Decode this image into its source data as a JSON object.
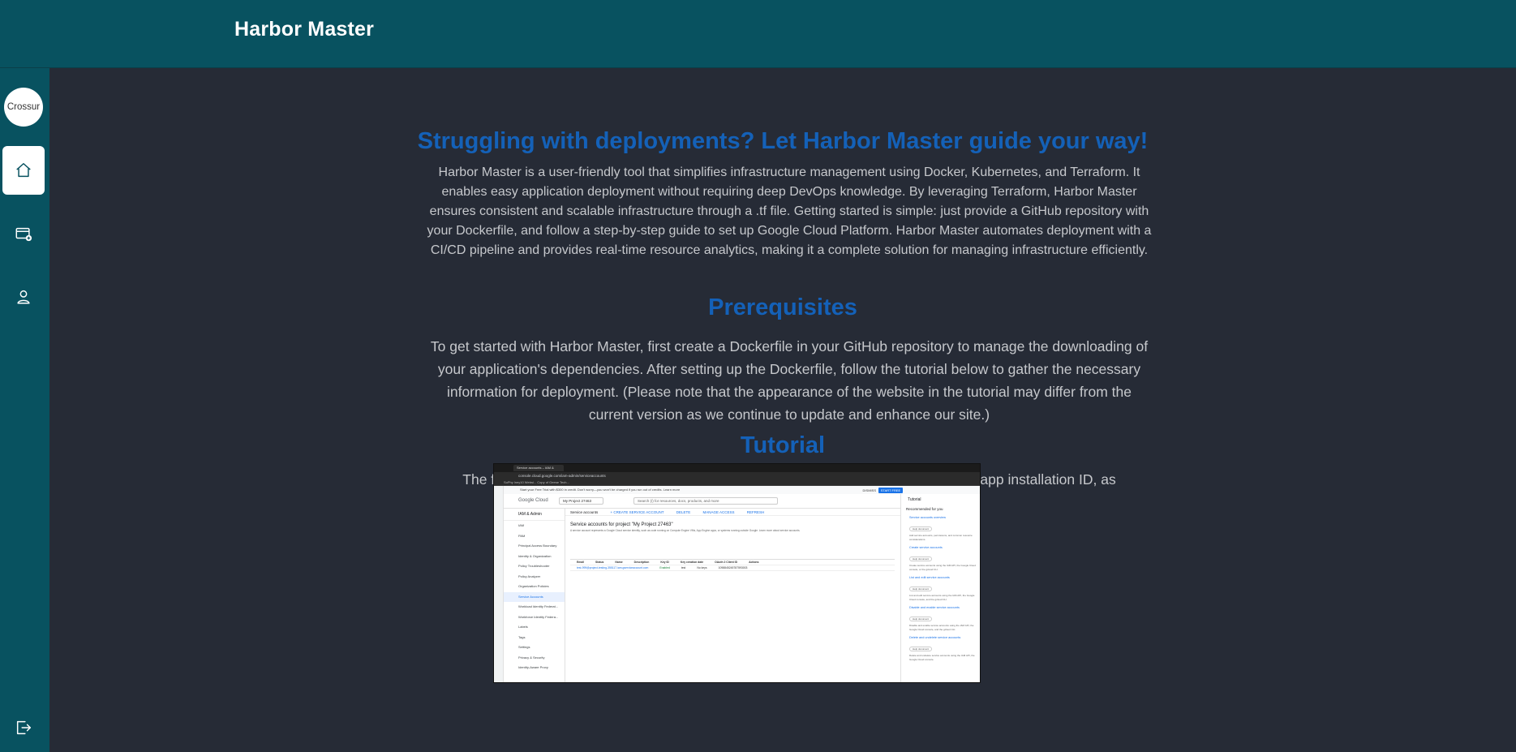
{
  "app": {
    "title": "Harbor Master"
  },
  "sidebar": {
    "avatar_text": "Crossur",
    "items": [
      {
        "name": "home-icon"
      },
      {
        "name": "new-deployment-icon"
      },
      {
        "name": "user-icon"
      },
      {
        "name": "logout-icon"
      }
    ]
  },
  "intro": {
    "heading": "Struggling with deployments? Let Harbor Master guide your way!",
    "body": "Harbor Master is a user-friendly tool that simplifies infrastructure management using Docker, Kubernetes, and Terraform. It enables easy application deployment without requiring deep DevOps knowledge. By leveraging Terraform, Harbor Master ensures consistent and scalable infrastructure through a .tf file. Getting started is simple: just provide a GitHub repository with your Dockerfile, and follow a step-by-step guide to set up Google Cloud Platform. Harbor Master automates deployment with a CI/CD pipeline and provides real-time resource analytics, making it a complete solution for managing infrastructure efficiently."
  },
  "prerequisites": {
    "heading": "Prerequisites",
    "body": "To get started with Harbor Master, first create a Dockerfile in your GitHub repository to manage the downloading of your application's dependencies. After setting up the Dockerfile, follow the tutorial below to gather the necessary information for deployment. (Please note that the appearance of the website in the tutorial may differ from the current version as we continue to update and enhance our site.)"
  },
  "tutorial": {
    "heading": "Tutorial",
    "body": "The first step is to add Google Cloud Build with your GitHub account and save the app installation ID, as demonstrated below.",
    "screenshot": {
      "tab_title": "Service accounts – IAM &",
      "url": "console.cloud.google.com/iam-admin/serviceaccounts",
      "bookmarks": "SoPhy lney10 Websi...   Copy of Geese Tech...",
      "banner": "Start your Free Trial with $300 in credit. Don't worry—you won't be charged if you run out of credits. Learn more",
      "dismiss": "DISMISS",
      "start_free": "START FREE",
      "brand": "Google Cloud",
      "project": "My Project 27463",
      "search_placeholder": "Search (/) for resources, docs, products, and more",
      "nav_title": "IAM & Admin",
      "nav_items": [
        "IAM",
        "PAM",
        "Principal Access Boundary",
        "Identity & Organization",
        "Policy Troubleshooter",
        "Policy Analyzer",
        "Organization Policies",
        "Service Accounts",
        "Workload Identity Federat...",
        "Workforce Identity Federa...",
        "Labels",
        "Tags",
        "Settings",
        "Privacy & Security",
        "Identity-Aware Proxy"
      ],
      "toolbar_title": "Service accounts",
      "toolbar_actions": [
        "+ CREATE SERVICE ACCOUNT",
        "DELETE",
        "MANAGE ACCESS",
        "REFRESH"
      ],
      "main_heading": "Service accounts for project \"My Project 27463\"",
      "fine_print": "A service account represents a Google Cloud service identity, such as code running on Compute Engine VMs, App Engine apps, or systems running outside Google. Learn more about service accounts.",
      "table_header": [
        "Email",
        "Status",
        "Name",
        "Description",
        "Key ID",
        "Key creation date",
        "OAuth 2 Client ID",
        "Actions"
      ],
      "table_row": [
        "test-999@project-testing-355117.iam.gserviceaccount.com",
        "Enabled",
        "test",
        "",
        "No keys",
        "",
        "1098845245787593003",
        ""
      ],
      "panel_title": "Tutorial",
      "panel_sub": "Recommended for you",
      "panel_items": [
        {
          "title": "Service accounts overview",
          "tag": "Help document",
          "desc": "Add service accounts, permissions, and common resource considerations."
        },
        {
          "title": "Create service accounts",
          "tag": "Help document",
          "desc": "Create service accounts using the IAM API, the Google Cloud console, or the gcloud CLI."
        },
        {
          "title": "List and edit service accounts",
          "tag": "Help document",
          "desc": "List and edit service accounts using the IAM API, the Google Cloud console, and the gcloud CLI."
        },
        {
          "title": "Disable and enable service accounts",
          "tag": "Help document",
          "desc": "Disable and enable service accounts using the IAM API, the Google Cloud console, and the gcloud CLI."
        },
        {
          "title": "Delete and undelete service accounts",
          "tag": "Help document",
          "desc": "Delete and undelete service accounts using the IAM API, the Google Cloud console."
        }
      ]
    }
  },
  "colors": {
    "topbar": "#085260",
    "background": "#262b36",
    "heading": "#1461b8",
    "text": "#c6c8cc"
  }
}
